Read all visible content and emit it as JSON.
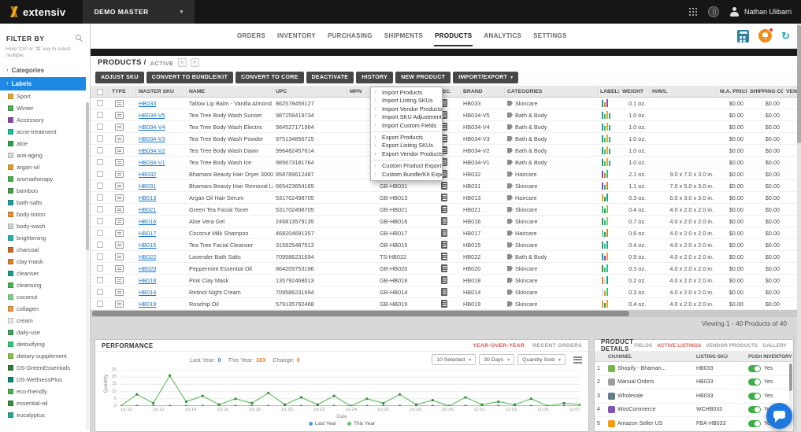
{
  "topbar": {
    "logo": "extensiv",
    "account_selector": "DEMO MASTER",
    "user_name": "Nathan Ulibarri"
  },
  "nav": {
    "tabs": [
      {
        "label": "ORDERS",
        "active": false
      },
      {
        "label": "INVENTORY",
        "active": false
      },
      {
        "label": "PURCHASING",
        "active": false
      },
      {
        "label": "SHIPMENTS",
        "active": false
      },
      {
        "label": "PRODUCTS",
        "active": true
      },
      {
        "label": "ANALYTICS",
        "active": false
      },
      {
        "label": "SETTINGS",
        "active": false
      }
    ]
  },
  "sidebar": {
    "title": "FILTER BY",
    "hint": "Hold 'Ctrl' or '⌘' key to select multiple.",
    "categories_label": "Categories",
    "labels_label": "Labels",
    "labels": [
      {
        "name": "Sport",
        "color": "#f0a030"
      },
      {
        "name": "Winter",
        "color": "#4caf50"
      },
      {
        "name": "Accessory",
        "color": "#8e44ad"
      },
      {
        "name": "acne-treatment",
        "color": "#1abc9c"
      },
      {
        "name": "aloe",
        "color": "#2e9e4f"
      },
      {
        "name": "anti-aging",
        "color": "#d7dbdd"
      },
      {
        "name": "argan-oil",
        "color": "#e59b27"
      },
      {
        "name": "aromatherapy",
        "color": "#45b04a"
      },
      {
        "name": "bamboo",
        "color": "#3f9e46"
      },
      {
        "name": "bath-salts",
        "color": "#17a2a6"
      },
      {
        "name": "body-lotion",
        "color": "#ef8e2e"
      },
      {
        "name": "body-wash",
        "color": "#cfd4d6"
      },
      {
        "name": "brightening",
        "color": "#20b2aa"
      },
      {
        "name": "charcoal",
        "color": "#c96a1f"
      },
      {
        "name": "clay-mask",
        "color": "#e67e22"
      },
      {
        "name": "cleanser",
        "color": "#16a085"
      },
      {
        "name": "cleansing",
        "color": "#43b649"
      },
      {
        "name": "coconut",
        "color": "#7dce82"
      },
      {
        "name": "collagen",
        "color": "#ef9a3c"
      },
      {
        "name": "cream",
        "color": "#e8e8e0"
      },
      {
        "name": "daily-use",
        "color": "#3aa655"
      },
      {
        "name": "detoxifying",
        "color": "#2ecc71"
      },
      {
        "name": "dietary-supplement",
        "color": "#8bc34a"
      },
      {
        "name": "DS-GreenEssentials",
        "color": "#2e7d32"
      },
      {
        "name": "DS-WellnessPlus",
        "color": "#00897b"
      },
      {
        "name": "eco-friendly",
        "color": "#4caf50"
      },
      {
        "name": "essential-oil",
        "color": "#388e3c"
      },
      {
        "name": "eucalyptus",
        "color": "#26a69a"
      }
    ]
  },
  "breadcrumb": {
    "section": "PRODUCTS /",
    "status": "ACTIVE"
  },
  "toolbar": {
    "buttons": [
      {
        "label": "ADJUST SKU"
      },
      {
        "label": "CONVERT TO BUNDLE/KIT"
      },
      {
        "label": "CONVERT TO CORE"
      },
      {
        "label": "DEACTIVATE"
      },
      {
        "label": "HISTORY"
      },
      {
        "label": "NEW PRODUCT"
      },
      {
        "label": "IMPORT/EXPORT",
        "caret": true,
        "open": true
      }
    ]
  },
  "import_export_menu": {
    "groups": [
      [
        {
          "label": "Import Products",
          "dir": "up"
        },
        {
          "label": "Import Listing SKUs",
          "dir": "up"
        },
        {
          "label": "Import Vendor Products",
          "dir": "up"
        },
        {
          "label": "Import SKU Adjustments",
          "dir": "up"
        },
        {
          "label": "Import Custom Fields",
          "dir": "up"
        }
      ],
      [
        {
          "label": "Export Products",
          "dir": "down"
        },
        {
          "label": "Export Listing SKUs",
          "dir": "down"
        },
        {
          "label": "Export Vendor Products",
          "dir": "down"
        }
      ],
      [
        {
          "label": "Custom Product Export",
          "dir": "custom"
        },
        {
          "label": "Custom Bundle/Kit Export",
          "dir": "custom"
        }
      ]
    ]
  },
  "table": {
    "columns": [
      "",
      "TYPE",
      "MASTER SKU",
      "NAME",
      "UPC",
      "MPN",
      "",
      "DESC.",
      "BRAND",
      "CATEGORIES",
      "LABELS",
      "WEIGHT",
      "H/W/L",
      "M.A. PRICE",
      "SHIPPING COST",
      "VEND..."
    ],
    "viewing": "Viewing 1 - 40 Products of 40",
    "rows": [
      {
        "master_sku": "HB033",
        "name": "Tallow Lip Balm - Vanilla Almond",
        "upc": "862578456127",
        "mpn": "",
        "aka": "",
        "brand": "HB033",
        "category": "Skincare",
        "label_colors": [
          "#16a085",
          "#e67e22",
          "#8e44ad"
        ],
        "weight": "0.1 oz.",
        "hwl": "",
        "ma_price": "$0.00",
        "shipping_cost": "$0.00"
      },
      {
        "master_sku": "HB034-V5",
        "name": "Tea Tree Body Wash Sunset",
        "upc": "987258419734",
        "mpn": "",
        "aka": "",
        "brand": "HB034-V5",
        "category": "Bath & Body",
        "label_colors": [
          "#16a085",
          "#2ecc71",
          "#f0a030",
          "#26a69a"
        ],
        "weight": "1.0 oz.",
        "hwl": "",
        "ma_price": "$0.00",
        "shipping_cost": "$0.00"
      },
      {
        "master_sku": "HB034-V4",
        "name": "Tea Tree Body Wash Electric",
        "upc": "984527171964",
        "mpn": "",
        "aka": "",
        "brand": "HB034-V4",
        "category": "Bath & Body",
        "label_colors": [
          "#16a085",
          "#2ecc71",
          "#f0a030",
          "#26a69a"
        ],
        "weight": "1.0 oz.",
        "hwl": "",
        "ma_price": "$0.00",
        "shipping_cost": "$0.00"
      },
      {
        "master_sku": "HB034-V3",
        "name": "Tea Tree Body Wash Powder",
        "upc": "975134856715",
        "mpn": "",
        "aka": "",
        "brand": "HB034-V3",
        "category": "Bath & Body",
        "label_colors": [
          "#16a085",
          "#2ecc71",
          "#f0a030",
          "#26a69a"
        ],
        "weight": "1.0 oz.",
        "hwl": "",
        "ma_price": "$0.00",
        "shipping_cost": "$0.00"
      },
      {
        "master_sku": "HB034-V2",
        "name": "Tea Tree Body Wash Dawn",
        "upc": "996482457614",
        "mpn": "",
        "aka": "",
        "brand": "HB034-V2",
        "category": "Bath & Body",
        "label_colors": [
          "#16a085",
          "#2ecc71",
          "#f0a030",
          "#26a69a"
        ],
        "weight": "1.0 oz.",
        "hwl": "",
        "ma_price": "$0.00",
        "shipping_cost": "$0.00"
      },
      {
        "master_sku": "HB034-V1",
        "name": "Tea Tree Body Wash Ice",
        "upc": "985673181764",
        "mpn": "",
        "aka": "",
        "brand": "HB034-V1",
        "category": "Bath & Body",
        "label_colors": [
          "#16a085",
          "#2ecc71",
          "#f0a030",
          "#26a69a"
        ],
        "weight": "1.0 oz.",
        "hwl": "",
        "ma_price": "$0.00",
        "shipping_cost": "$0.00"
      },
      {
        "master_sku": "HB032",
        "name": "Bhamani Beauty Hair Dryer 3000",
        "upc": "858789612487",
        "mpn": "",
        "aka": "GB-HB032",
        "brand": "HB032",
        "category": "Haircare",
        "label_colors": [
          "#8e44ad",
          "#e67e22",
          "#2ecc71"
        ],
        "weight": "2.1 oz.",
        "hwl": "9.0 x 7.0 x 3.0 in.",
        "ma_price": "$0.00",
        "shipping_cost": "$0.00"
      },
      {
        "master_sku": "HB031",
        "name": "Bhamani Beauty Hair Removal Laser",
        "upc": "665423654165",
        "mpn": "",
        "aka": "GB-HB031",
        "brand": "HB031",
        "category": "Skincare",
        "label_colors": [
          "#8e44ad",
          "#1abc9c",
          "#e67e22"
        ],
        "weight": "1.1 oz.",
        "hwl": "7.0 x 5.0 x 3.0 in.",
        "ma_price": "$0.00",
        "shipping_cost": "$0.00"
      },
      {
        "master_sku": "HB013",
        "name": "Argan Oil Hair Serum",
        "upc": "531702498705",
        "mpn": "",
        "aka": "GB-HB013",
        "brand": "HB013",
        "category": "Haircare",
        "label_colors": [
          "#e59b27",
          "#2e9e4f",
          "#16a085"
        ],
        "weight": "0.3 oz.",
        "hwl": "6.0 x 3.0 x 3.0 in.",
        "ma_price": "$0.00",
        "shipping_cost": "$0.00"
      },
      {
        "master_sku": "HB021",
        "name": "Green Tea Facial Toner",
        "upc": "531702498705",
        "mpn": "",
        "aka": "GB-HB021",
        "brand": "HB021",
        "category": "Skincare",
        "label_colors": [
          "#2ecc71",
          "#16a085",
          "#8bc34a"
        ],
        "weight": "0.4 oz.",
        "hwl": "4.0 x 2.0 x 2.0 in.",
        "ma_price": "$0.00",
        "shipping_cost": "$0.00"
      },
      {
        "master_sku": "HB016",
        "name": "Aloe Vera Gel",
        "upc": "246813579135",
        "mpn": "",
        "aka": "GB-HB016",
        "brand": "HB016",
        "category": "Skincare",
        "label_colors": [
          "#2e9e4f",
          "#1abc9c",
          "#7dce82"
        ],
        "weight": "0.7 oz.",
        "hwl": "4.0 x 2.0 x 2.0 in.",
        "ma_price": "$0.00",
        "shipping_cost": "$0.00"
      },
      {
        "master_sku": "HB017",
        "name": "Coconut Milk Shampoo",
        "upc": "468204691357",
        "mpn": "",
        "aka": "GB-HB017",
        "brand": "HB017",
        "category": "Haircare",
        "label_colors": [
          "#7dce82",
          "#16a085",
          "#e67e22"
        ],
        "weight": "0.6 oz.",
        "hwl": "4.0 x 2.0 x 2.0 in.",
        "ma_price": "$0.00",
        "shipping_cost": "$0.00"
      },
      {
        "master_sku": "HB015",
        "name": "Tea Tree Facial Cleanser",
        "upc": "315925487013",
        "mpn": "",
        "aka": "GB-HB015",
        "brand": "HB015",
        "category": "Skincare",
        "label_colors": [
          "#16a085",
          "#2ecc71",
          "#26a69a"
        ],
        "weight": "0.4 oz.",
        "hwl": "4.0 x 2.0 x 2.0 in.",
        "ma_price": "$0.00",
        "shipping_cost": "$0.00"
      },
      {
        "master_sku": "HB022",
        "name": "Lavender Bath Salts",
        "upc": "709586231694",
        "mpn": "",
        "aka": "TS-HB022",
        "brand": "HB022",
        "category": "Bath & Body",
        "label_colors": [
          "#17a2a6",
          "#8e44ad",
          "#f0a030"
        ],
        "weight": "0.9 oz.",
        "hwl": "4.0 x 2.0 x 2.0 in.",
        "ma_price": "$0.00",
        "shipping_cost": "$0.00"
      },
      {
        "master_sku": "HB020",
        "name": "Peppermint Essential Oil",
        "upc": "864209753186",
        "mpn": "",
        "aka": "GB-HB020",
        "brand": "HB020",
        "category": "Skincare",
        "label_colors": [
          "#388e3c",
          "#2ecc71",
          "#1abc9c"
        ],
        "weight": "0.3 oz.",
        "hwl": "4.0 x 2.0 x 2.0 in.",
        "ma_price": "$0.00",
        "shipping_cost": "$0.00"
      },
      {
        "master_sku": "HB018",
        "name": "Pink Clay Mask",
        "upc": "135792468013",
        "mpn": "",
        "aka": "GB-HB018",
        "brand": "HB018",
        "category": "Skincare",
        "label_colors": [
          "#e67e22",
          "#d7dbdd",
          "#16a085"
        ],
        "weight": "0.2 oz.",
        "hwl": "4.0 x 2.0 x 2.0 in.",
        "ma_price": "$0.00",
        "shipping_cost": "$0.00"
      },
      {
        "master_sku": "HB014",
        "name": "Retinol Night Cream",
        "upc": "709586231694",
        "mpn": "",
        "aka": "GB-HB014",
        "brand": "HB014",
        "category": "Skincare",
        "label_colors": [
          "#d7dbdd",
          "#e59b27",
          "#2ecc71"
        ],
        "weight": "0.3 oz.",
        "hwl": "4.0 x 2.0 x 2.0 in.",
        "ma_price": "$0.00",
        "shipping_cost": "$0.00"
      },
      {
        "master_sku": "HB019",
        "name": "Rosehip Oil",
        "upc": "579135792468",
        "mpn": "",
        "aka": "GB-HB019",
        "brand": "HB019",
        "category": "Skincare",
        "label_colors": [
          "#e59b27",
          "#2e9e4f",
          "#f0a030"
        ],
        "weight": "0.4 oz.",
        "hwl": "4.0 x 2.0 x 2.0 in.",
        "ma_price": "$0.00",
        "shipping_cost": "$0.00"
      }
    ]
  },
  "performance": {
    "title": "PERFORMANCE",
    "tabs": [
      {
        "label": "YEAR-OVER-YEAR",
        "active": true
      },
      {
        "label": "RECENT ORDERS",
        "active": false
      }
    ],
    "stats": [
      {
        "label": "Last Year:",
        "value": "0",
        "color": "#2a7ab9"
      },
      {
        "label": "This Year:",
        "value": "103",
        "color": "#e67e22"
      },
      {
        "label": "Change:",
        "value": "0",
        "color": "#e67e22"
      }
    ],
    "selectors": [
      {
        "label": "10 Selected"
      },
      {
        "label": "30 Days"
      },
      {
        "label": "Quantity Sold"
      }
    ],
    "chart_data": {
      "type": "line",
      "title": "",
      "xlabel": "Date",
      "ylabel": "Quantity",
      "ylim": [
        0,
        25
      ],
      "y_ticks": [
        0,
        5,
        10,
        15,
        20,
        25
      ],
      "grid": true,
      "legend_position": "bottom",
      "x_ticks": [
        "10-10",
        "10-12",
        "10-14",
        "10-16",
        "10-18",
        "10-20",
        "10-22",
        "10-24",
        "10-26",
        "10-28",
        "10-30",
        "11-01",
        "11-03",
        "11-05",
        "11-07"
      ],
      "series": [
        {
          "name": "Last Year",
          "color": "#5b9bd5",
          "point_color": "#3a7bbf",
          "values": [
            0,
            0,
            0,
            0,
            0,
            0,
            0,
            0,
            0,
            0,
            0,
            0,
            0,
            0,
            0,
            0,
            0,
            0,
            0,
            0,
            0,
            0,
            0,
            0,
            0,
            0,
            0,
            0,
            0
          ]
        },
        {
          "name": "This Year",
          "color": "#6abf69",
          "point_color": "#388e3c",
          "values": [
            0,
            8,
            2,
            21,
            3,
            7,
            1,
            5,
            2,
            9,
            1,
            6,
            1,
            7,
            0,
            5,
            2,
            8,
            1,
            4,
            0,
            6,
            1,
            3,
            1,
            5,
            0,
            2,
            1
          ]
        }
      ]
    }
  },
  "product_details": {
    "title": "PRODUCT DETAILS",
    "tabs": [
      {
        "label": "FIELDS",
        "active": false
      },
      {
        "label": "ACTIVE LISTINGS",
        "active": true
      },
      {
        "label": "VENDOR PRODUCTS",
        "active": false
      },
      {
        "label": "GALLERY",
        "active": false
      }
    ],
    "columns": [
      "CHANNEL",
      "LISTING SKU",
      "PUSH INVENTORY"
    ],
    "rows": [
      {
        "num": "1",
        "channel": "Shopify - Bhaman...",
        "icon_color": "#7ab648",
        "listing_sku": "HB033",
        "push": "Yes"
      },
      {
        "num": "2",
        "channel": "Manual Orders",
        "icon_color": "#9e9e9e",
        "listing_sku": "HB033",
        "push": "Yes"
      },
      {
        "num": "3",
        "channel": "Wholesale",
        "icon_color": "#607d8b",
        "listing_sku": "HB033",
        "push": "Yes"
      },
      {
        "num": "4",
        "channel": "WooCommerce",
        "icon_color": "#7f54b3",
        "listing_sku": "WCHB033",
        "push": "Yes"
      },
      {
        "num": "5",
        "channel": "Amazon Seller US",
        "icon_color": "#f59e0b",
        "listing_sku": "FBA-HB033",
        "push": "Yes"
      }
    ]
  }
}
